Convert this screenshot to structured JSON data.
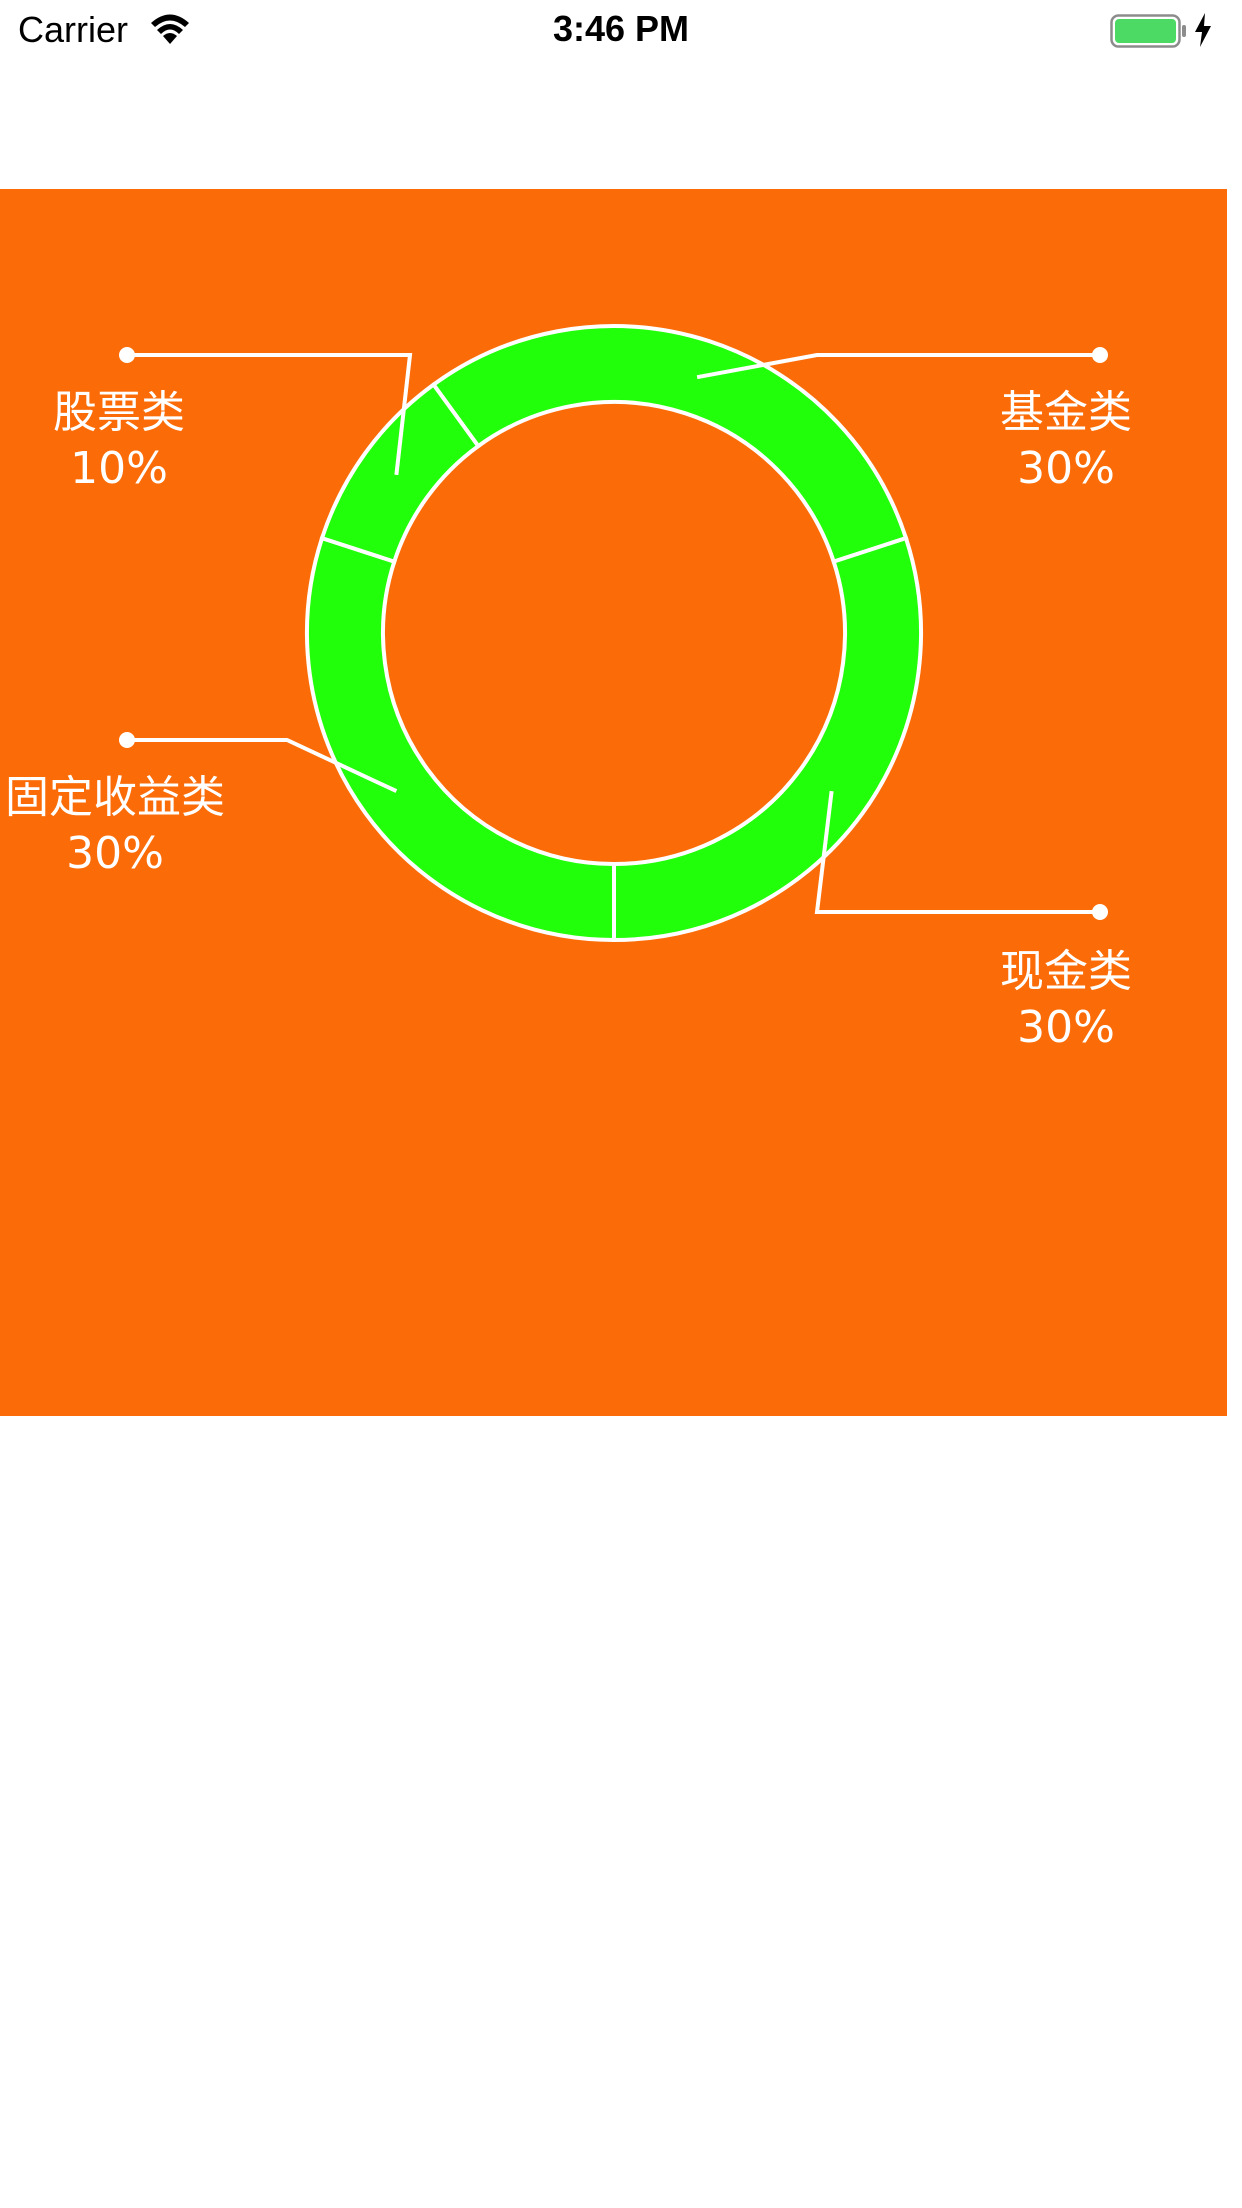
{
  "status_bar": {
    "carrier": "Carrier",
    "time": "3:46 PM"
  },
  "colors": {
    "panel_background": "#fb6c08",
    "ring_fill": "#22ff0a",
    "stroke": "#ffffff"
  },
  "chart_data": {
    "type": "pie",
    "style": "donut",
    "slices": [
      {
        "name": "基金类",
        "percent_label": "30%",
        "value": 30
      },
      {
        "name": "现金类",
        "percent_label": "30%",
        "value": 30
      },
      {
        "name": "固定收益类",
        "percent_label": "30%",
        "value": 30
      },
      {
        "name": "股票类",
        "percent_label": "10%",
        "value": 10
      }
    ]
  }
}
